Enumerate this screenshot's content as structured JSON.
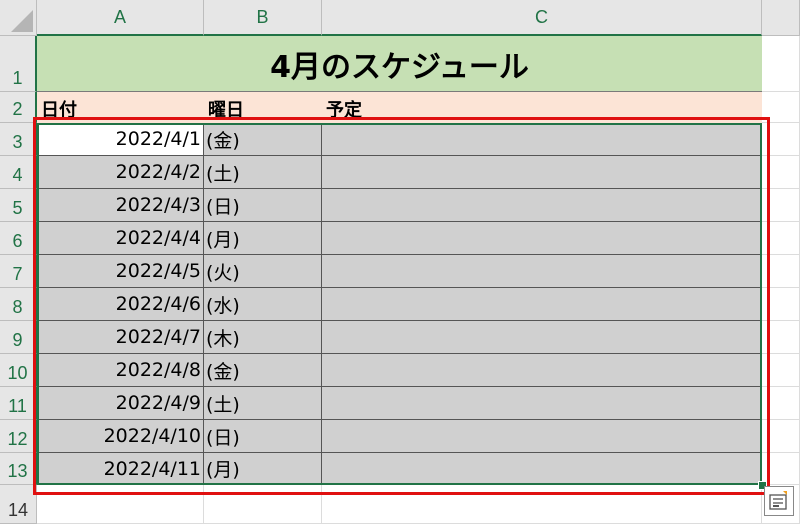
{
  "columns": [
    "A",
    "B",
    "C"
  ],
  "rows": [
    "1",
    "2",
    "3",
    "4",
    "5",
    "6",
    "7",
    "8",
    "9",
    "10",
    "11",
    "12",
    "13",
    "14"
  ],
  "title": "4月のスケジュール",
  "headers": {
    "a": "日付",
    "b": "曜日",
    "c": "予定"
  },
  "data_rows": [
    {
      "date": "2022/4/1",
      "day": "(金)",
      "plan": ""
    },
    {
      "date": "2022/4/2",
      "day": "(土)",
      "plan": ""
    },
    {
      "date": "2022/4/3",
      "day": "(日)",
      "plan": ""
    },
    {
      "date": "2022/4/4",
      "day": "(月)",
      "plan": ""
    },
    {
      "date": "2022/4/5",
      "day": "(火)",
      "plan": ""
    },
    {
      "date": "2022/4/6",
      "day": "(水)",
      "plan": ""
    },
    {
      "date": "2022/4/7",
      "day": "(木)",
      "plan": ""
    },
    {
      "date": "2022/4/8",
      "day": "(金)",
      "plan": ""
    },
    {
      "date": "2022/4/9",
      "day": "(土)",
      "plan": ""
    },
    {
      "date": "2022/4/10",
      "day": "(日)",
      "plan": ""
    },
    {
      "date": "2022/4/11",
      "day": "(月)",
      "plan": ""
    }
  ],
  "selection_range": "A3:C13",
  "icons": {
    "quick_analysis": "quick-analysis-icon",
    "select_all": "select-all-triangle-icon"
  },
  "colors": {
    "title_fill": "#c6e0b4",
    "header_fill": "#fce4d6",
    "selection": "#217346",
    "highlight": "#e01010"
  }
}
